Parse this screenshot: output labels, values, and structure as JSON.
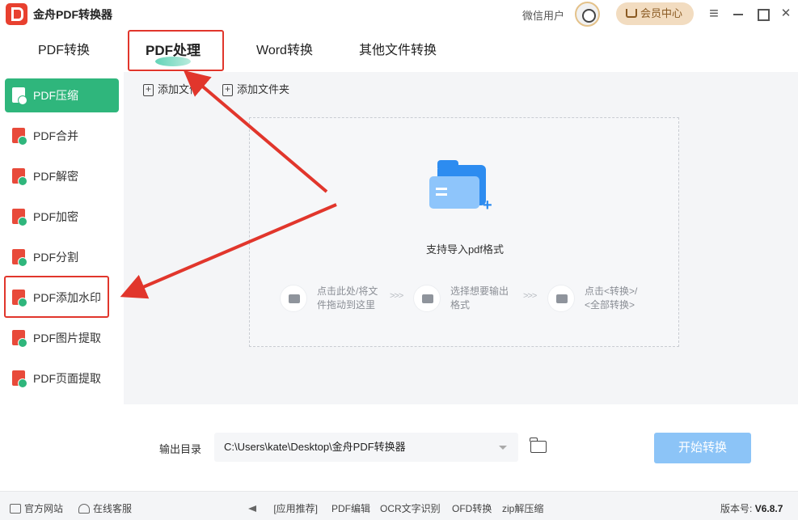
{
  "app": {
    "title": "金舟PDF转换器"
  },
  "user": {
    "name": "微信用户",
    "vip_label": "会员中心"
  },
  "tabs": [
    {
      "label": "PDF转换"
    },
    {
      "label": "PDF处理"
    },
    {
      "label": "Word转换"
    },
    {
      "label": "其他文件转换"
    }
  ],
  "active_tab": "PDF处理",
  "sidebar": {
    "items": [
      {
        "label": "PDF压缩",
        "active": true
      },
      {
        "label": "PDF合并"
      },
      {
        "label": "PDF解密"
      },
      {
        "label": "PDF加密"
      },
      {
        "label": "PDF分割"
      },
      {
        "label": "PDF添加水印"
      },
      {
        "label": "PDF图片提取"
      },
      {
        "label": "PDF页面提取"
      }
    ]
  },
  "toolbar": {
    "add_file": "添加文件",
    "add_folder": "添加文件夹"
  },
  "dropzone": {
    "text": "支持导入pdf格式",
    "steps": [
      {
        "line1": "点击此处/将文",
        "line2": "件拖动到这里"
      },
      {
        "line1": "选择想要输出",
        "line2": "格式"
      },
      {
        "line1": "点击<转换>/",
        "line2": "<全部转换>"
      }
    ],
    "separator": ">>>"
  },
  "output": {
    "label": "输出目录",
    "path": "C:\\Users\\kate\\Desktop\\金舟PDF转换器",
    "start_button": "开始转换"
  },
  "statusbar": {
    "website": "官方网站",
    "support": "在线客服",
    "promo": "[应用推荐]",
    "links": [
      "PDF编辑",
      "OCR文字识别",
      "OFD转换",
      "zip解压缩"
    ],
    "version_label": "版本号:",
    "version": "V6.8.7"
  },
  "colors": {
    "accent_green": "#2fb67c",
    "start_button": "#8cc4f7",
    "annotation_red": "#e1362c",
    "pdf_red": "#e84a3a"
  }
}
